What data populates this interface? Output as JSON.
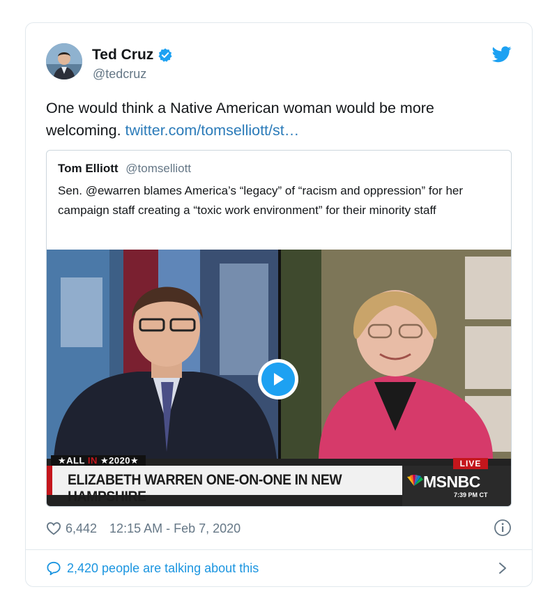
{
  "tweet": {
    "author_name": "Ted Cruz",
    "author_handle": "@tedcruz",
    "text_prefix": "One would think a Native American woman would be more welcoming.",
    "link_text": "twitter.com/tomselliott/st…",
    "likes": "6,442",
    "timestamp": "12:15 AM - Feb 7, 2020",
    "talking_text": "2,420 people are talking about this"
  },
  "quoted": {
    "author_name": "Tom Elliott",
    "author_handle": "@tomselliott",
    "text": "Sen. @ewarren blames America’s “legacy” of “racism and oppression” for her campaign staff creating a “toxic work environment” for their minority staff"
  },
  "video": {
    "chyron_tag_left": "★ALL",
    "chyron_tag_in": "IN",
    "chyron_tag_right": "★2020★",
    "chyron_headline": "ELIZABETH WARREN ONE-ON-ONE IN NEW HAMPSHIRE",
    "live_label": "LIVE",
    "network": "MSNBC",
    "clock": "7:39 PM CT"
  },
  "icons": {
    "verified": "verified-badge-icon",
    "bird": "twitter-bird-icon",
    "play": "play-icon",
    "heart": "heart-icon",
    "info": "info-icon",
    "bubble": "speech-bubble-icon",
    "chevron": "chevron-right-icon"
  },
  "colors": {
    "link": "#2b7bb9",
    "twitter_blue": "#1da1f2",
    "muted": "#657786",
    "msnbc_red": "#c4161c"
  }
}
